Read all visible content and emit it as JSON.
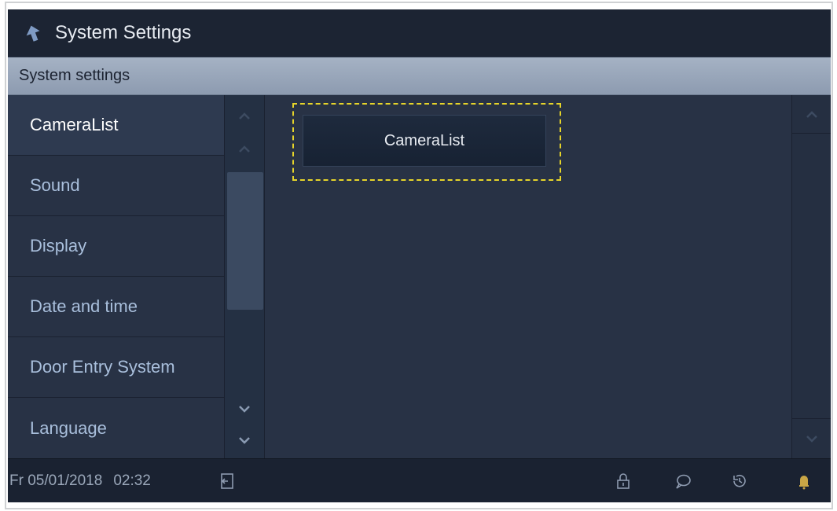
{
  "header": {
    "title": "System Settings"
  },
  "section": {
    "title": "System settings"
  },
  "menu": {
    "items": [
      {
        "label": "CameraList",
        "active": true
      },
      {
        "label": "Sound",
        "active": false
      },
      {
        "label": "Display",
        "active": false
      },
      {
        "label": "Date and time",
        "active": false
      },
      {
        "label": "Door Entry System",
        "active": false
      },
      {
        "label": "Language",
        "active": false
      }
    ]
  },
  "content": {
    "button_label": "CameraList"
  },
  "status": {
    "date": "Fr 05/01/2018",
    "time": "02:32",
    "icons": [
      "logout-icon",
      "lock-icon",
      "message-icon",
      "history-icon",
      "bell-icon"
    ]
  },
  "colors": {
    "highlight": "#e6d42a",
    "background": "#283245",
    "header": "#8d9bb0"
  }
}
